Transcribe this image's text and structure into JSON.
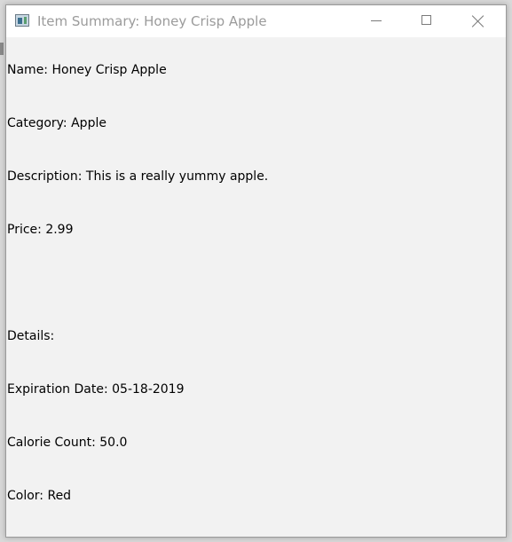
{
  "window": {
    "title": "Item Summary: Honey Crisp Apple"
  },
  "content": {
    "lines": [
      "Name: Honey Crisp Apple",
      "Category: Apple",
      "Description: This is a really yummy apple.",
      "Price: 2.99",
      "",
      "Details:",
      "Expiration Date: 05-18-2019",
      "Calorie Count: 50.0",
      "Color: Red"
    ]
  },
  "icons": {
    "app": "java-app-icon",
    "minimize": "minimize-icon",
    "maximize": "maximize-icon",
    "close": "close-icon"
  }
}
